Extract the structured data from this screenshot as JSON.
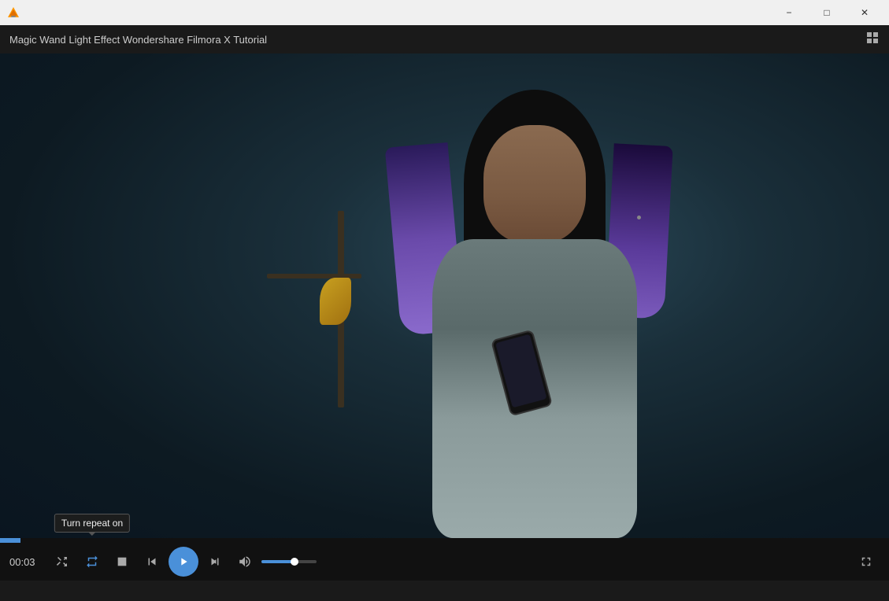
{
  "titleBar": {
    "appIconLabel": "VLC Media Player icon",
    "minimize": "−",
    "maximize": "□",
    "close": "✕"
  },
  "appHeader": {
    "title": "Magic Wand Light Effect  Wondershare Filmora X Tutorial",
    "gridIcon": "⊞"
  },
  "controls": {
    "timeDisplay": "00:03",
    "progressPercent": 2.3,
    "volumePercent": 60,
    "buttons": {
      "shuffle": "shuffle-icon",
      "repeat": "repeat-icon",
      "stop": "stop-icon",
      "rewind": "rewind-icon",
      "play": "play-icon",
      "fastforward": "fastforward-icon",
      "volume": "volume-icon",
      "fullscreen": "fullscreen-icon"
    },
    "tooltip": "Turn repeat on"
  }
}
